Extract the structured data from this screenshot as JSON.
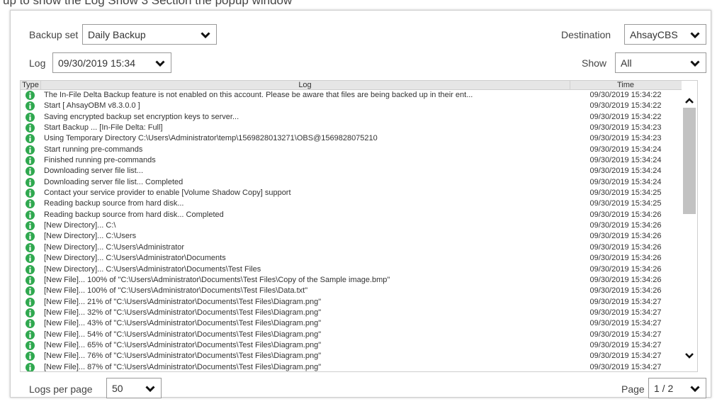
{
  "caption": "up to show the Log Show 3 Section the popup window",
  "backup_set": {
    "label": "Backup set",
    "value": "Daily Backup"
  },
  "destination": {
    "label": "Destination",
    "value": "AhsayCBS"
  },
  "log_select": {
    "label": "Log",
    "value": "09/30/2019 15:34"
  },
  "show_select": {
    "label": "Show",
    "value": "All"
  },
  "table": {
    "headers": {
      "type": "Type",
      "log": "Log",
      "time": "Time"
    },
    "row_icon": "info-icon",
    "icon_color": "#2fa84f",
    "rows": [
      {
        "log": "The In-File Delta Backup feature is not enabled on this account. Please be aware that files are being backed up in their ent...",
        "time": "09/30/2019 15:34:22"
      },
      {
        "log": "Start [ AhsayOBM v8.3.0.0 ]",
        "time": "09/30/2019 15:34:22"
      },
      {
        "log": "Saving encrypted backup set encryption keys to server...",
        "time": "09/30/2019 15:34:22"
      },
      {
        "log": "Start Backup ... [In-File Delta: Full]",
        "time": "09/30/2019 15:34:23"
      },
      {
        "log": "Using Temporary Directory C:\\Users\\Administrator\\temp\\1569828013271\\OBS@1569828075210",
        "time": "09/30/2019 15:34:23"
      },
      {
        "log": "Start running pre-commands",
        "time": "09/30/2019 15:34:24"
      },
      {
        "log": "Finished running pre-commands",
        "time": "09/30/2019 15:34:24"
      },
      {
        "log": "Downloading server file list...",
        "time": "09/30/2019 15:34:24"
      },
      {
        "log": "Downloading server file list... Completed",
        "time": "09/30/2019 15:34:24"
      },
      {
        "log": "Contact your service provider to enable [Volume Shadow Copy] support",
        "time": "09/30/2019 15:34:25"
      },
      {
        "log": "Reading backup source from hard disk...",
        "time": "09/30/2019 15:34:25"
      },
      {
        "log": "Reading backup source from hard disk... Completed",
        "time": "09/30/2019 15:34:26"
      },
      {
        "log": "[New Directory]... C:\\",
        "time": "09/30/2019 15:34:26"
      },
      {
        "log": "[New Directory]... C:\\Users",
        "time": "09/30/2019 15:34:26"
      },
      {
        "log": "[New Directory]... C:\\Users\\Administrator",
        "time": "09/30/2019 15:34:26"
      },
      {
        "log": "[New Directory]... C:\\Users\\Administrator\\Documents",
        "time": "09/30/2019 15:34:26"
      },
      {
        "log": "[New Directory]... C:\\Users\\Administrator\\Documents\\Test Files",
        "time": "09/30/2019 15:34:26"
      },
      {
        "log": "[New File]... 100% of \"C:\\Users\\Administrator\\Documents\\Test Files\\Copy of the Sample image.bmp\"",
        "time": "09/30/2019 15:34:26"
      },
      {
        "log": "[New File]... 100% of \"C:\\Users\\Administrator\\Documents\\Test Files\\Data.txt\"",
        "time": "09/30/2019 15:34:26"
      },
      {
        "log": "[New File]... 21% of \"C:\\Users\\Administrator\\Documents\\Test Files\\Diagram.png\"",
        "time": "09/30/2019 15:34:27"
      },
      {
        "log": "[New File]... 32% of \"C:\\Users\\Administrator\\Documents\\Test Files\\Diagram.png\"",
        "time": "09/30/2019 15:34:27"
      },
      {
        "log": "[New File]... 43% of \"C:\\Users\\Administrator\\Documents\\Test Files\\Diagram.png\"",
        "time": "09/30/2019 15:34:27"
      },
      {
        "log": "[New File]... 54% of \"C:\\Users\\Administrator\\Documents\\Test Files\\Diagram.png\"",
        "time": "09/30/2019 15:34:27"
      },
      {
        "log": "[New File]... 65% of \"C:\\Users\\Administrator\\Documents\\Test Files\\Diagram.png\"",
        "time": "09/30/2019 15:34:27"
      },
      {
        "log": "[New File]... 76% of \"C:\\Users\\Administrator\\Documents\\Test Files\\Diagram.png\"",
        "time": "09/30/2019 15:34:27"
      },
      {
        "log": "[New File]... 87% of \"C:\\Users\\Administrator\\Documents\\Test Files\\Diagram.png\"",
        "time": "09/30/2019 15:34:27"
      }
    ]
  },
  "logs_per_page": {
    "label": "Logs per page",
    "value": "50"
  },
  "page_select": {
    "label": "Page",
    "value": "1 / 2"
  }
}
